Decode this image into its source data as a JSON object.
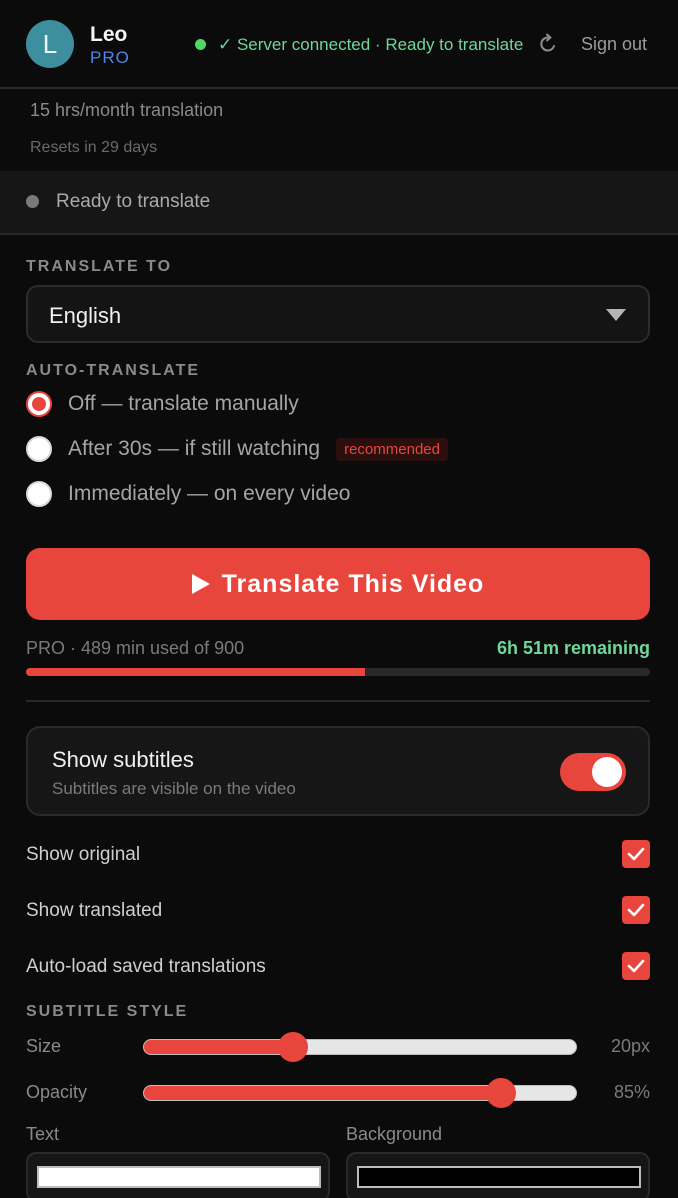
{
  "user": {
    "initial": "L",
    "name": "Leo",
    "plan": "PRO"
  },
  "header": {
    "server_status": "✓ Server connected · Ready to translate",
    "sign_out": "Sign out"
  },
  "quota": {
    "line": "15 hrs/month translation",
    "reset": "Resets in 29 days"
  },
  "status": {
    "text": "Ready to translate"
  },
  "translate_to": {
    "title": "TRANSLATE TO",
    "selected": "English"
  },
  "auto_translate": {
    "title": "AUTO-TRANSLATE",
    "options": [
      {
        "label": "Off — translate manually",
        "checked": true
      },
      {
        "label": "After 30s — if still watching",
        "badge": "recommended",
        "checked": false
      },
      {
        "label": "Immediately — on every video",
        "checked": false
      }
    ]
  },
  "translate_button": {
    "label": "Translate This Video"
  },
  "usage": {
    "text": "PRO · 489 min used of 900",
    "remaining": "6h 51m remaining",
    "used_min": 489,
    "total_min": 900
  },
  "subtitles": {
    "title": "Show subtitles",
    "desc": "Subtitles are visible on the video",
    "enabled": true
  },
  "options": [
    {
      "label": "Show original",
      "checked": true
    },
    {
      "label": "Show translated",
      "checked": true
    },
    {
      "label": "Auto-load saved translations",
      "checked": true
    }
  ],
  "subtitle_style": {
    "title": "SUBTITLE STYLE",
    "size": {
      "label": "Size",
      "value": "20px",
      "fraction": 0.345
    },
    "opacity": {
      "label": "Opacity",
      "value": "85%",
      "fraction": 0.825
    },
    "text_label": "Text",
    "background_label": "Background",
    "text_color": "#ffffff",
    "background_color": "#000000"
  },
  "colors": {
    "accent": "#e8453c",
    "success": "#6fd79a",
    "plan": "#4f86e8"
  }
}
